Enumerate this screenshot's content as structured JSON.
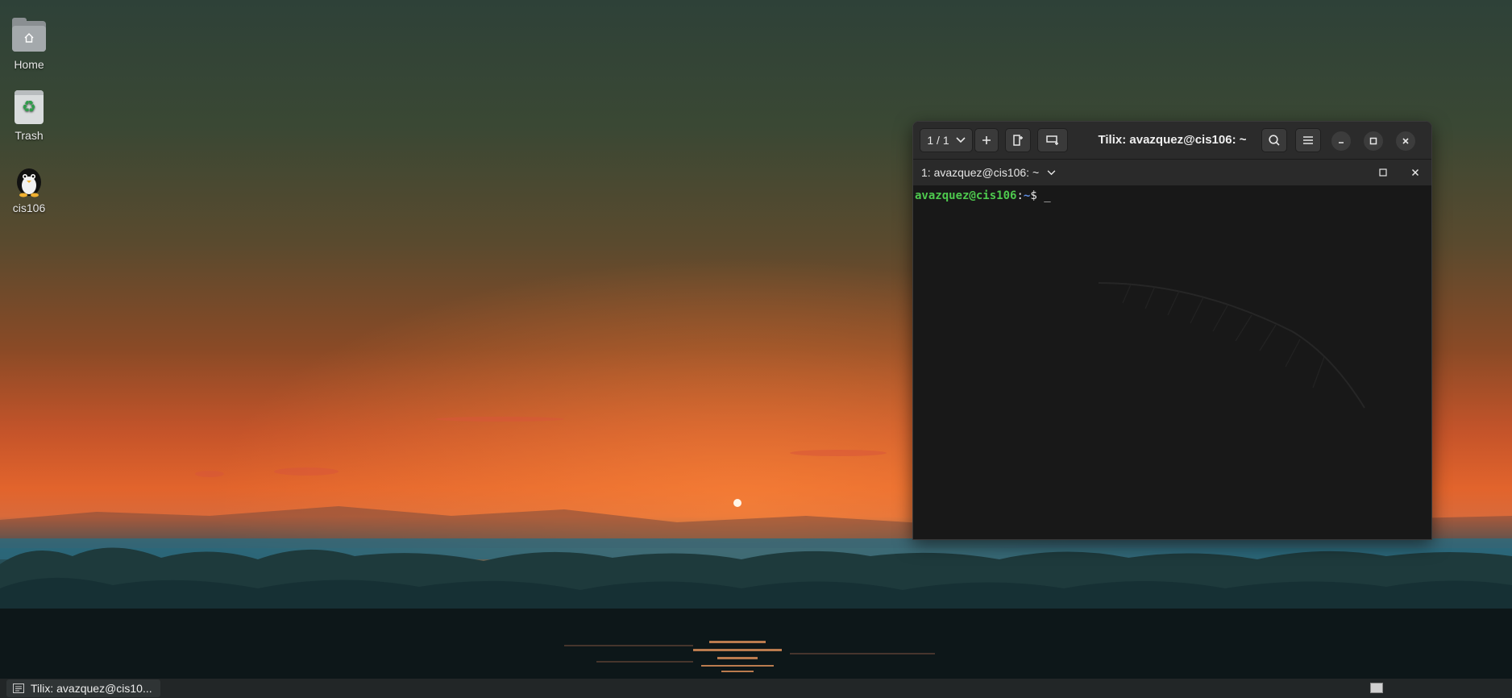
{
  "desktop": {
    "icons": [
      {
        "label": "Home"
      },
      {
        "label": "Trash"
      },
      {
        "label": "cis106"
      }
    ]
  },
  "terminal_window": {
    "title": "Tilix: avazquez@cis106: ~",
    "session_switcher_label": "1 / 1",
    "add_session_icon": "plus-icon",
    "terminal_tab_label": "1: avazquez@cis106: ~",
    "prompt": {
      "user_host": "avazquez@cis106",
      "separator": ":",
      "path": "~",
      "symbol": "$",
      "cursor": "_"
    }
  },
  "taskbar": {
    "task_label": "Tilix: avazquez@cis10..."
  },
  "colors": {
    "prompt_user": "#4ec94e",
    "prompt_path": "#5e8de3",
    "terminal_bg": "#181818",
    "headerbar_bg": "#2b2b2b"
  }
}
